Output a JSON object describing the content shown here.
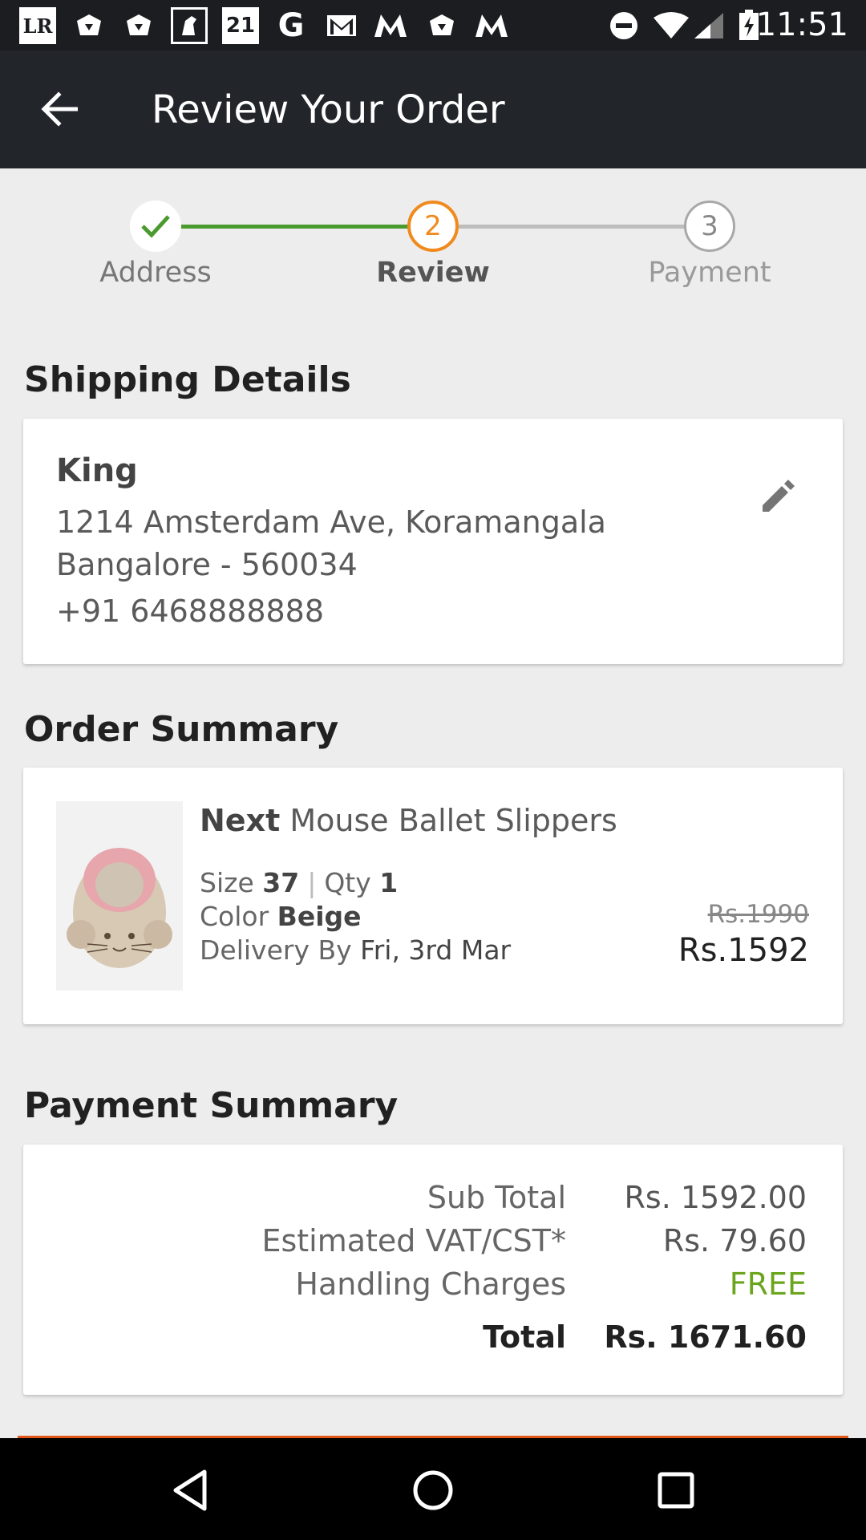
{
  "status_bar": {
    "time": "11:51",
    "left_icons": [
      "LR",
      "21"
    ]
  },
  "app_bar": {
    "title": "Review Your Order"
  },
  "stepper": {
    "steps": [
      {
        "label": "Address",
        "number": "",
        "state": "done"
      },
      {
        "label": "Review",
        "number": "2",
        "state": "active"
      },
      {
        "label": "Payment",
        "number": "3",
        "state": "pending"
      }
    ]
  },
  "shipping": {
    "title": "Shipping Details",
    "name": "King",
    "address_line1": "1214 Amsterdam Ave, Koramangala",
    "address_line2": "Bangalore - 560034",
    "phone": "+91 6468888888"
  },
  "order": {
    "title": "Order Summary",
    "brand": "Next",
    "product": "Mouse Ballet Slippers",
    "size_label": "Size",
    "size": "37",
    "qty_label": "Qty",
    "qty": "1",
    "color_label": "Color",
    "color": "Beige",
    "delivery_label": "Delivery By",
    "delivery": "Fri, 3rd Mar",
    "price_old": "Rs.1990",
    "price_new": "Rs.1592"
  },
  "payment": {
    "title": "Payment Summary",
    "rows": [
      {
        "label": "Sub Total",
        "value": "Rs. 1592.00"
      },
      {
        "label": "Estimated VAT/CST*",
        "value": "Rs. 79.60"
      },
      {
        "label": "Handling Charges",
        "value": "FREE"
      },
      {
        "label": "Total",
        "value": "Rs. 1671.60"
      }
    ]
  },
  "colors": {
    "app_bar": "#22262b",
    "accent_orange": "#f08a1d",
    "done_green": "#4a9a2d",
    "free_green": "#6ba51e"
  }
}
